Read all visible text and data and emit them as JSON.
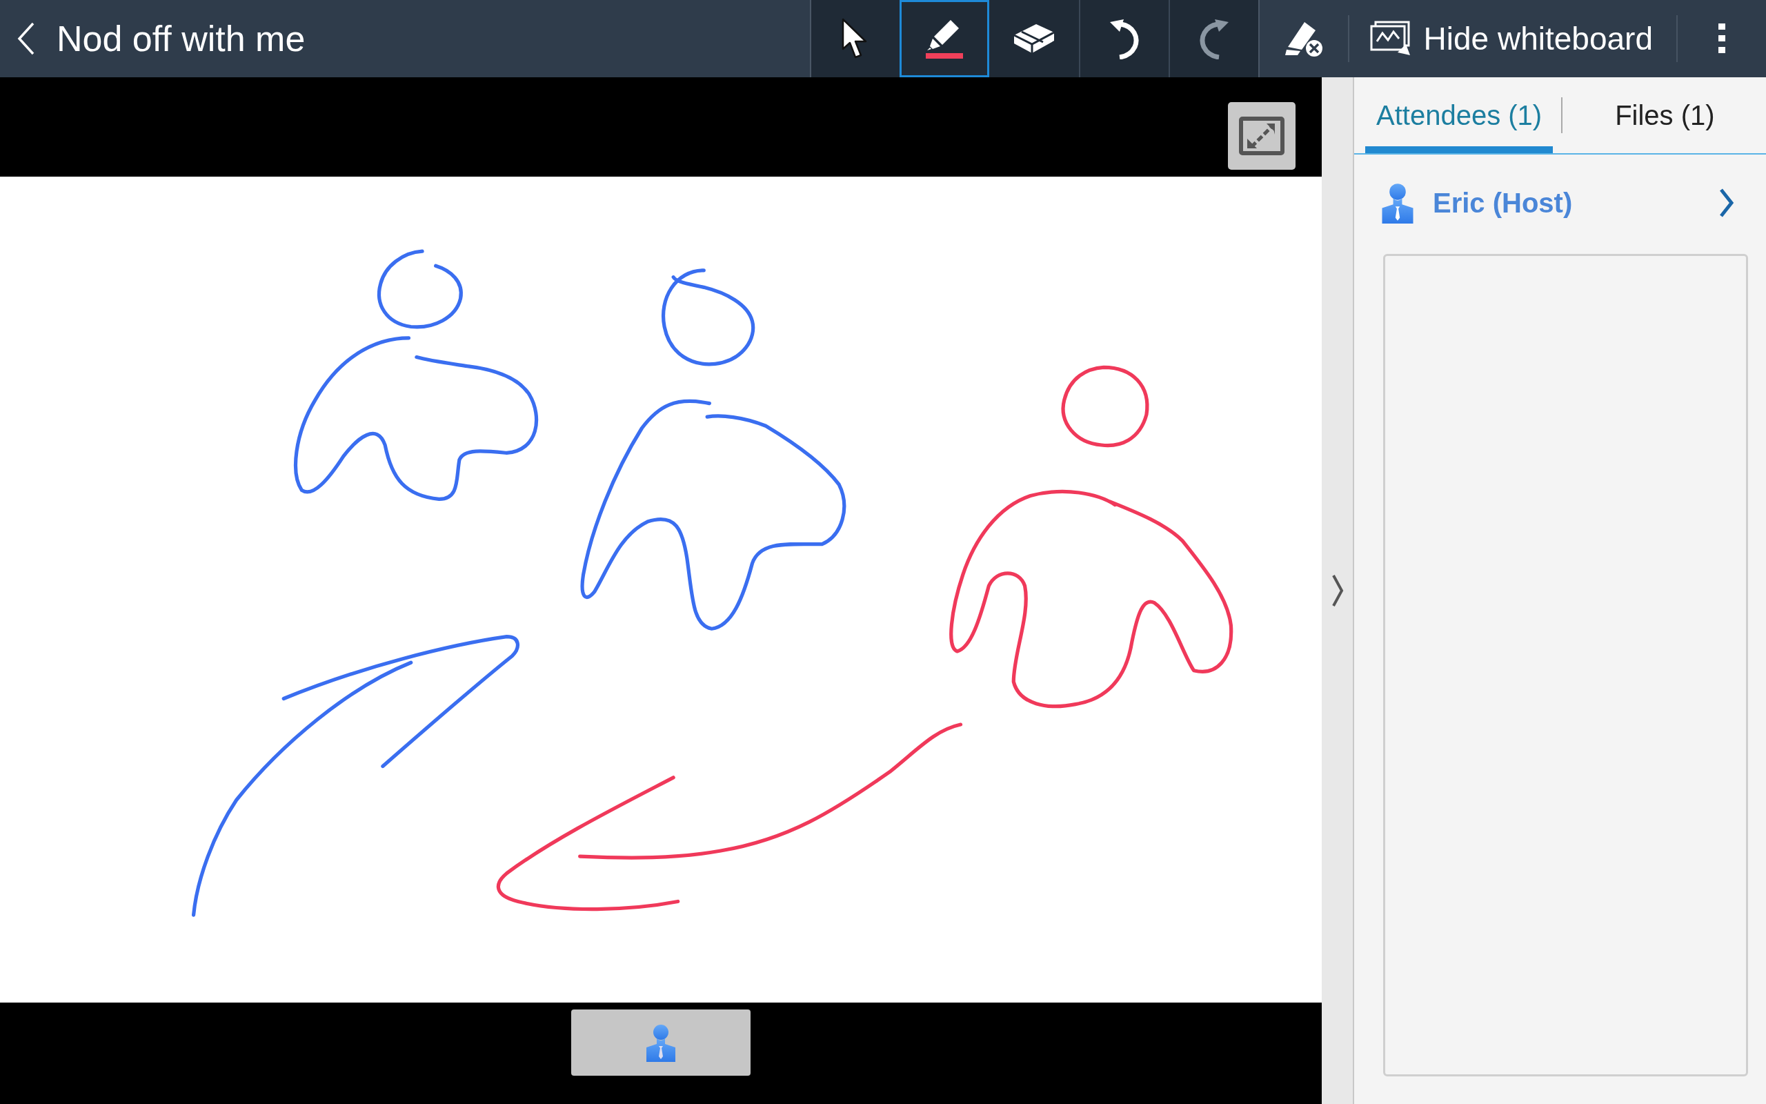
{
  "app_bar": {
    "title": "Nod off with me"
  },
  "tools": [
    {
      "kind": "select",
      "selected": false,
      "disabled": false
    },
    {
      "kind": "pen",
      "selected": true,
      "disabled": false
    },
    {
      "kind": "eraser",
      "selected": false,
      "disabled": false
    },
    {
      "kind": "undo",
      "selected": false,
      "disabled": false
    },
    {
      "kind": "redo",
      "selected": false,
      "disabled": true
    }
  ],
  "hide_button": {
    "label": "Hide whiteboard"
  },
  "tabs": [
    {
      "label": "Attendees (1)",
      "selected": true
    },
    {
      "label": "Files (1)",
      "selected": false
    }
  ],
  "attendees": [
    {
      "name": "Eric (Host)"
    }
  ]
}
